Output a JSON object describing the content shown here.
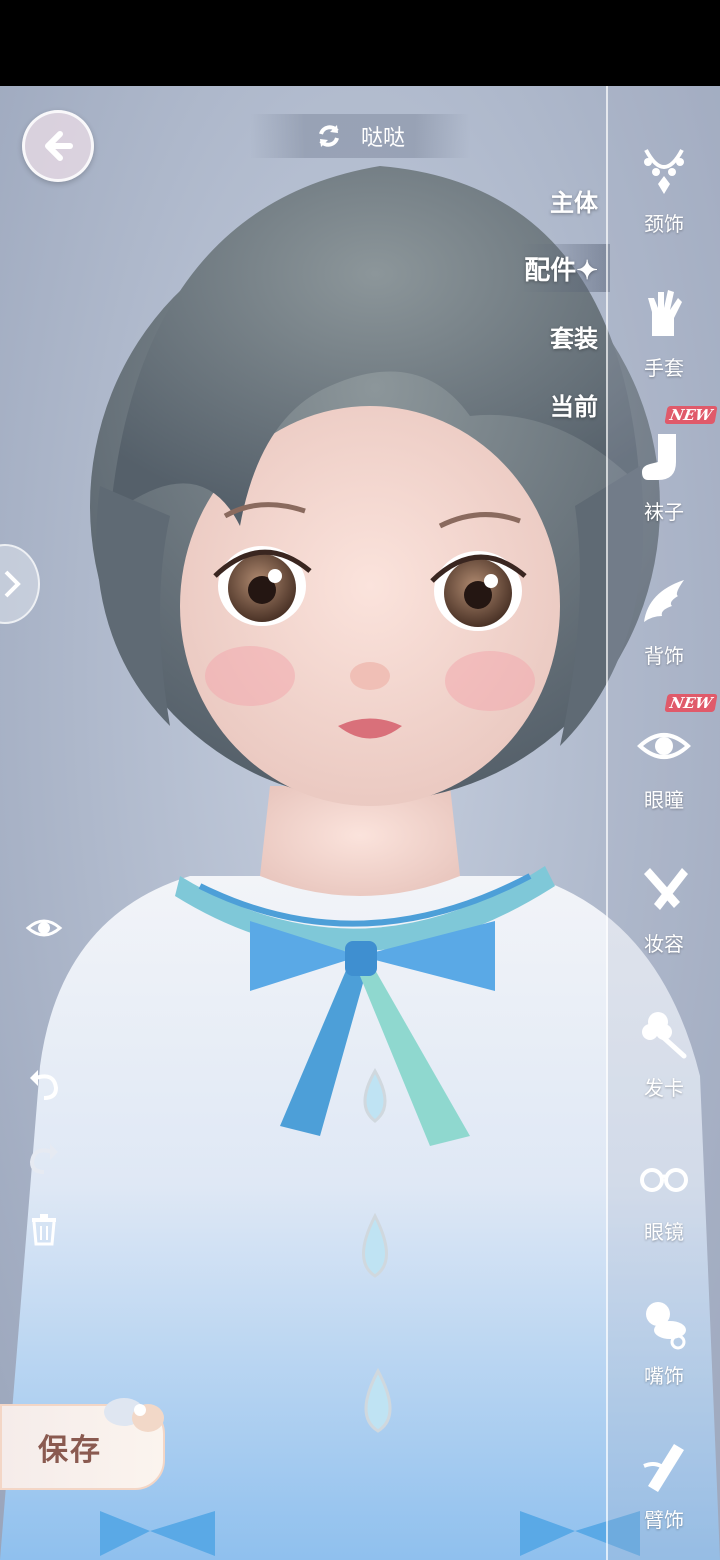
{
  "header": {
    "character_name": "哒哒",
    "back_icon": "arrow-left-icon",
    "switch_icon": "refresh-icon"
  },
  "category_tabs": [
    {
      "label": "主体",
      "active": false
    },
    {
      "label": "配件✦",
      "active": true
    },
    {
      "label": "套装",
      "active": false
    },
    {
      "label": "当前",
      "active": false
    }
  ],
  "accessories": [
    {
      "label": "颈饰",
      "icon": "necklace-icon",
      "new": ""
    },
    {
      "label": "手套",
      "icon": "glove-icon",
      "new": ""
    },
    {
      "label": "袜子",
      "icon": "sock-icon",
      "new": "NEW"
    },
    {
      "label": "背饰",
      "icon": "wing-icon",
      "new": ""
    },
    {
      "label": "眼瞳",
      "icon": "eye-icon",
      "new": "NEW"
    },
    {
      "label": "妆容",
      "icon": "makeup-brush-icon",
      "new": ""
    },
    {
      "label": "发卡",
      "icon": "hairclip-icon",
      "new": ""
    },
    {
      "label": "眼镜",
      "icon": "glasses-icon",
      "new": ""
    },
    {
      "label": "嘴饰",
      "icon": "pacifier-icon",
      "new": ""
    },
    {
      "label": "臂饰",
      "icon": "armlet-icon",
      "new": ""
    }
  ],
  "tools": {
    "visibility": "eye-toggle-icon",
    "undo": "undo-icon",
    "redo": "redo-icon",
    "delete": "trash-icon"
  },
  "save_label": "保存",
  "colors": {
    "background": "#aeb8cb",
    "accent_new": "#e05a6a",
    "save_text": "#8a5a50",
    "outfit_blue": "#7fb4e6"
  }
}
